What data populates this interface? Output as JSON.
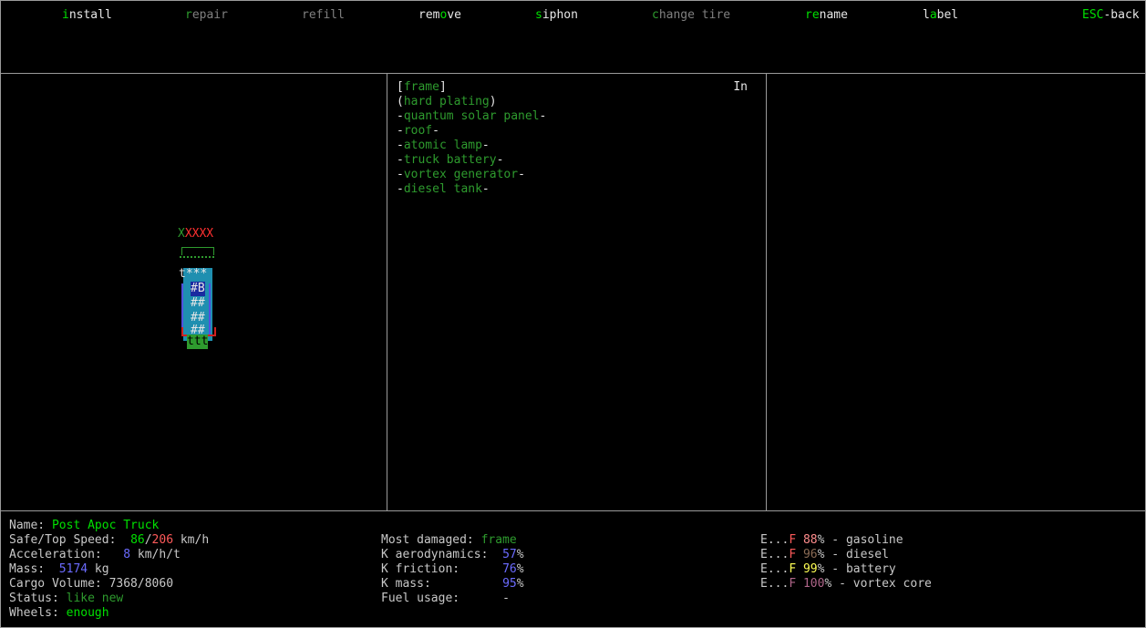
{
  "menu": [
    {
      "pre": "",
      "key": "i",
      "post": "nstall",
      "enabled": true
    },
    {
      "pre": "",
      "key": "r",
      "post": "epair",
      "enabled": false
    },
    {
      "pre": "",
      "key": "",
      "post": "refill",
      "enabled": false
    },
    {
      "pre": "rem",
      "key": "o",
      "post": "ve",
      "enabled": true
    },
    {
      "pre": "",
      "key": "s",
      "post": "iphon",
      "enabled": true
    },
    {
      "pre": "",
      "key": "c",
      "post": "hange tire",
      "enabled": false
    },
    {
      "pre": "",
      "key": "re",
      "post": "name",
      "enabled": true
    },
    {
      "pre": "l",
      "key": "a",
      "post": "bel",
      "enabled": true
    },
    {
      "pre": "",
      "key": "ESC",
      "post": "-back",
      "enabled": true
    }
  ],
  "parts": {
    "in_label": "In",
    "items": [
      {
        "open": "[",
        "name": "frame",
        "close": "]"
      },
      {
        "open": "(",
        "name": "hard plating",
        "close": ")"
      },
      {
        "open": "-",
        "name": "quantum solar panel",
        "close": "-"
      },
      {
        "open": "-",
        "name": "roof",
        "close": "-"
      },
      {
        "open": "-",
        "name": "atomic lamp",
        "close": "-"
      },
      {
        "open": "-",
        "name": "truck battery",
        "close": "-"
      },
      {
        "open": "-",
        "name": "vortex generator",
        "close": "-"
      },
      {
        "open": "-",
        "name": "diesel tank",
        "close": "-"
      }
    ]
  },
  "vehicle_glyphs": {
    "top_x": "X",
    "top_xs": "XXXX",
    "rows": [
      "t***",
      "#B",
      "##",
      "##",
      "##",
      "ttt"
    ]
  },
  "info": {
    "name_label": "Name: ",
    "name_value": "Post Apoc Truck",
    "speed_label": "Safe/Top Speed:  ",
    "speed_safe": "86",
    "speed_sep": "/",
    "speed_top": "206",
    "speed_unit": " km/h",
    "accel_label": "Acceleration:   ",
    "accel_value": "8",
    "accel_unit": " km/h/t",
    "mass_label": "Mass:  ",
    "mass_value": "5174",
    "mass_unit": " kg",
    "cargo_label": "Cargo Volume: ",
    "cargo_value": "7368/8060",
    "status_label": "Status: ",
    "status_value": "like new",
    "wheels_label": "Wheels: ",
    "wheels_value": "enough"
  },
  "stats": {
    "damaged_label": "Most damaged: ",
    "damaged_value": "frame",
    "aero_label": "K aerodynamics:  ",
    "aero_value": "57",
    "friction_label": "K friction:      ",
    "friction_value": "76",
    "mass_label": "K mass:          ",
    "mass_value": "95",
    "fuel_label": "Fuel usage:      ",
    "fuel_value": "-"
  },
  "fuels": [
    {
      "pct": "88",
      "name": "gasoline",
      "color": "#ff8c8c"
    },
    {
      "pct": "96",
      "name": "diesel",
      "color": "#8b6b55"
    },
    {
      "pct": "99",
      "name": "battery",
      "color": "#ffff55"
    },
    {
      "pct": "100",
      "name": "vortex core",
      "color": "#b0668a"
    }
  ],
  "fuel_prefix": "E...F ",
  "pct_sign": "%",
  "fuel_sep": " - "
}
